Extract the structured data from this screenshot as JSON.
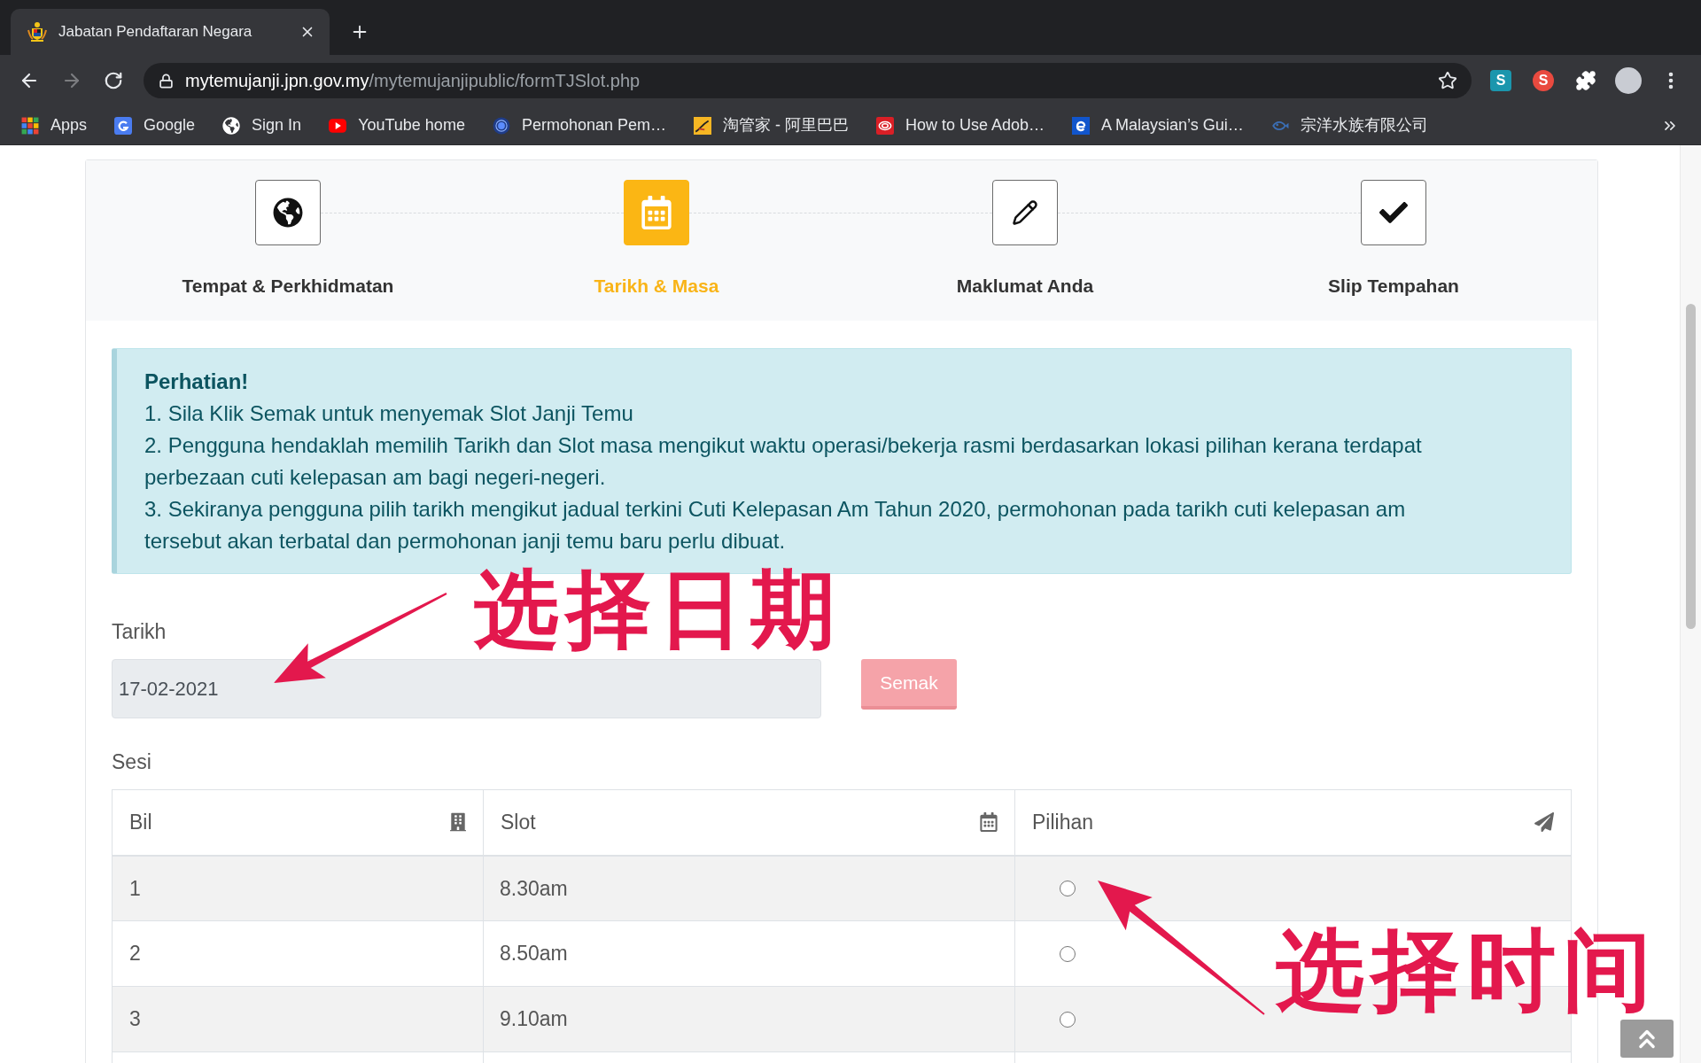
{
  "browser": {
    "tab": {
      "title": "Jabatan Pendaftaran Negara"
    },
    "address": {
      "host": "mytemujanji.jpn.gov.my",
      "path": "/mytemujanjipublic/formTJSlot.php"
    },
    "extensions": [
      {
        "label": "S",
        "kind": "square",
        "color": "#1b96ad"
      },
      {
        "label": "S",
        "kind": "circle",
        "color": "#e94a3f"
      }
    ],
    "bookmarks": [
      {
        "label": "Apps",
        "kind": "apps"
      },
      {
        "label": "Google",
        "kind": "google"
      },
      {
        "label": "Sign In",
        "kind": "globe"
      },
      {
        "label": "YouTube home",
        "kind": "youtube"
      },
      {
        "label": "Permohonan Pem…",
        "kind": "ring"
      },
      {
        "label": "淘管家 - 阿里巴巴",
        "kind": "taobao"
      },
      {
        "label": "How to Use Adob…",
        "kind": "adobe"
      },
      {
        "label": "A Malaysian’s Gui…",
        "kind": "ie"
      },
      {
        "label": "宗洋水族有限公司",
        "kind": "fish"
      }
    ]
  },
  "steps": [
    {
      "label": "Tempat & Perkhidmatan",
      "kind": "globe",
      "selected": false
    },
    {
      "label": "Tarikh & Masa",
      "kind": "calendar",
      "selected": true
    },
    {
      "label": "Maklumat Anda",
      "kind": "pencil",
      "selected": false
    },
    {
      "label": "Slip Tempahan",
      "kind": "check",
      "selected": false
    }
  ],
  "alert": {
    "title": "Perhatian!",
    "items": [
      "1. Sila Klik Semak untuk menyemak Slot Janji Temu",
      "2. Pengguna hendaklah memilih Tarikh dan Slot masa mengikut waktu operasi/bekerja rasmi berdasarkan lokasi pilihan kerana terdapat perbezaan cuti kelepasan am bagi negeri-negeri.",
      "3. Sekiranya pengguna pilih tarikh mengikut jadual terkini Cuti Kelepasan Am Tahun 2020, permohonan pada tarikh cuti kelepasan am tersebut akan terbatal dan permohonan janji temu baru perlu dibuat."
    ]
  },
  "form": {
    "date_label": "Tarikh",
    "date_value": "17-02-2021",
    "readonly": true,
    "check_button": {
      "label": "Semak",
      "disabled": true
    }
  },
  "sessions": {
    "label": "Sesi",
    "columns": [
      {
        "label": "Bil",
        "kind": "building"
      },
      {
        "label": "Slot",
        "kind": "calendar"
      },
      {
        "label": "Pilihan",
        "kind": "send"
      }
    ],
    "rows": [
      {
        "bil": "1",
        "slot": "8.30am",
        "selected": false
      },
      {
        "bil": "2",
        "slot": "8.50am",
        "selected": false
      },
      {
        "bil": "3",
        "slot": "9.10am",
        "selected": false
      }
    ]
  },
  "callouts": [
    {
      "text": "选择日期"
    },
    {
      "text": "选择时间"
    }
  ]
}
